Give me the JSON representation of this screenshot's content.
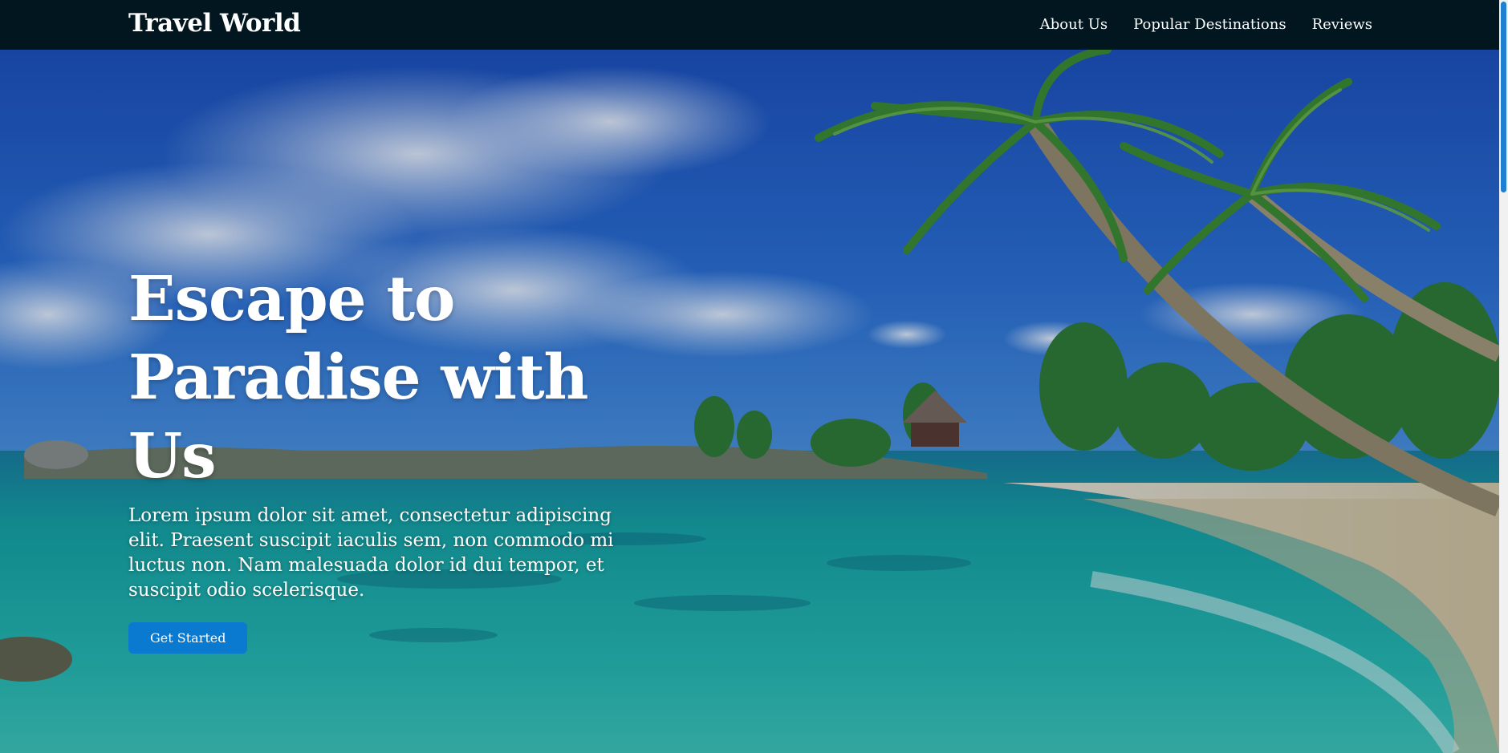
{
  "navbar": {
    "brand": "Travel World",
    "links": [
      {
        "label": "About Us"
      },
      {
        "label": "Popular Destinations"
      },
      {
        "label": "Reviews"
      }
    ]
  },
  "hero": {
    "title_line1": "Escape to",
    "title_line2": "Paradise with Us",
    "text": "Lorem ipsum dolor sit amet, consectetur adipiscing elit. Praesent suscipit iaculis sem, non commodo mi luctus non. Nam malesuada dolor id dui tempor, et suscipit odio scelerisque.",
    "cta_label": "Get Started",
    "background": "tropical beach with palm trees, turquoise water and white sand"
  },
  "colors": {
    "navbar_bg": "#021620",
    "button_bg": "#0a7ad0",
    "scrollbar_thumb": "#1f7fd0"
  }
}
